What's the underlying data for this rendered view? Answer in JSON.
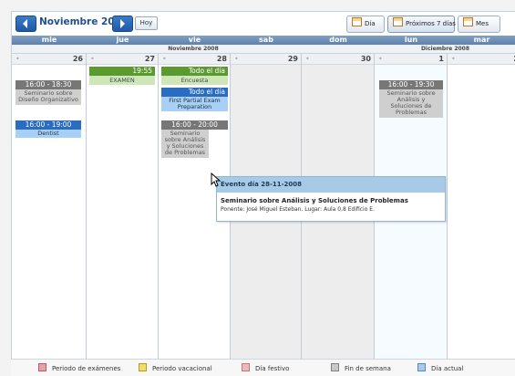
{
  "toolbar": {
    "title": "Noviembre 2008",
    "today_button": "Hoy",
    "views": [
      {
        "label": "Día",
        "active": false
      },
      {
        "label": "Próximos 7 días",
        "active": true
      },
      {
        "label": "Mes",
        "active": false
      }
    ]
  },
  "header": {
    "days": [
      "mie",
      "jue",
      "vie",
      "sab",
      "dom",
      "lun",
      "mar"
    ],
    "months": [
      "Noviembre 2008",
      "Diciembre 2008"
    ]
  },
  "columns": [
    {
      "day": "26"
    },
    {
      "day": "27"
    },
    {
      "day": "28"
    },
    {
      "day": "29"
    },
    {
      "day": "30"
    },
    {
      "day": "1"
    },
    {
      "day": "2"
    }
  ],
  "events": {
    "wed_seminar": {
      "time": "16:00 - 18:30",
      "title": "Seminario sobre Diseño Organizativo"
    },
    "wed_dentist": {
      "time": "16:00 - 19:00",
      "title": "Dentist"
    },
    "thu_exam": {
      "time": "19:55",
      "title": "EXAMEN"
    },
    "fri_encuesta": {
      "time": "Todo el día",
      "title": "Encuesta"
    },
    "fri_partial": {
      "time": "Todo el día",
      "title": "First Partial Exam Preparation"
    },
    "fri_seminar": {
      "time": "16:00 - 20:00",
      "title": "Seminario sobre Análisis y Soluciones de Problemas"
    },
    "mon_seminar": {
      "time": "16:00 - 19:30",
      "title": "Seminario sobre Análisis y Soluciones de Problemas"
    }
  },
  "tooltip": {
    "header": "Evento día 28-11-2008",
    "title": "Seminario sobre Análisis y Soluciones de Problemas",
    "detail": "Ponente: José Miguel Esteban. Lugar: Aula 0,8 Edificio E."
  },
  "legend": [
    {
      "label": "Periodo de exámenes",
      "color": "#e8a0a8"
    },
    {
      "label": "Periodo vacacional",
      "color": "#f3dd6a"
    },
    {
      "label": "Día festivo",
      "color": "#f0b8b8"
    },
    {
      "label": "Fin de semana",
      "color": "#c8c8c8"
    },
    {
      "label": "Día actual",
      "color": "#a9c8ee"
    }
  ],
  "colors": {
    "header_blue": "#6a8db5",
    "accent": "#1f5aa5"
  }
}
